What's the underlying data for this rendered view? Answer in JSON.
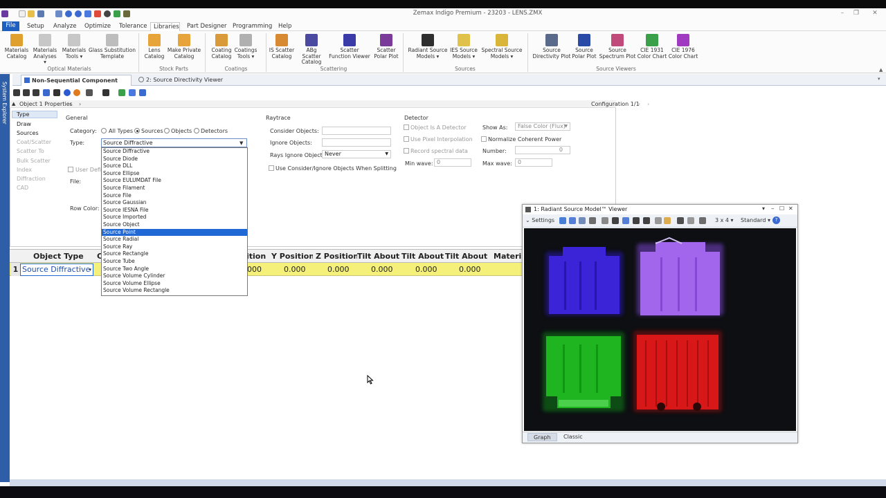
{
  "window": {
    "title": "Zemax Indigo Premium - 23203 - LENS.ZMX"
  },
  "menu": [
    "File",
    "Setup",
    "Analyze",
    "Optimize",
    "Tolerance",
    "Libraries",
    "Part Designer",
    "Programming",
    "Help"
  ],
  "ribbon": {
    "buttons": [
      {
        "l1": "Materials",
        "l2": "Catalog",
        "color": "#e0a030"
      },
      {
        "l1": "Materials",
        "l2": "Analyses ▾",
        "color": "#c7c7c7"
      },
      {
        "l1": "Materials",
        "l2": "Tools ▾",
        "color": "#c7c7c7"
      },
      {
        "l1": "Glass Substitution",
        "l2": "Template",
        "color": "#bdbdbd"
      },
      {
        "l1": "Lens",
        "l2": "Catalog",
        "color": "#e6a43a"
      },
      {
        "l1": "Make Private",
        "l2": "Catalog",
        "color": "#e6a43a"
      },
      {
        "l1": "Coating",
        "l2": "Catalog",
        "color": "#d99a3a"
      },
      {
        "l1": "Coatings",
        "l2": "Tools ▾",
        "color": "#b0b0b0"
      },
      {
        "l1": "IS Scatter",
        "l2": "Catalog",
        "color": "#d88a32"
      },
      {
        "l1": "ABg Scatter",
        "l2": "Catalog",
        "color": "#4a4aa0"
      },
      {
        "l1": "Scatter",
        "l2": "Function Viewer",
        "color": "#3a3aa8"
      },
      {
        "l1": "Scatter",
        "l2": "Polar Plot",
        "color": "#7a3a9a"
      },
      {
        "l1": "Radiant Source",
        "l2": "Models ▾",
        "color": "#2e2e2e"
      },
      {
        "l1": "IES Source",
        "l2": "Models ▾",
        "color": "#e0c24a"
      },
      {
        "l1": "Spectral Source",
        "l2": "Models ▾",
        "color": "#d9b63a"
      },
      {
        "l1": "Source",
        "l2": "Directivity Plot",
        "color": "#5a6a8a"
      },
      {
        "l1": "Source",
        "l2": "Polar Plot",
        "color": "#2a4aa8"
      },
      {
        "l1": "Source",
        "l2": "Spectrum Plot",
        "color": "#c04a7a"
      },
      {
        "l1": "CIE 1931",
        "l2": "Color Chart",
        "color": "#3aa04a"
      },
      {
        "l1": "CIE 1976",
        "l2": "Color Chart",
        "color": "#a03ac0"
      }
    ],
    "groups": [
      "Optical Materials",
      "Stock Parts",
      "Coatings",
      "Scattering",
      "Sources",
      "Source Viewers"
    ]
  },
  "tabs": [
    "Non-Sequential Component Editor",
    "2: Source Directivity Viewer"
  ],
  "side_explorer": "System Explorer",
  "props": {
    "header": "Object 1 Properties",
    "configuration": "Configuration 1/1",
    "nav": [
      "Type",
      "Draw",
      "Sources",
      "Coat/Scatter",
      "Scatter To",
      "Bulk Scatter",
      "Index",
      "Diffraction",
      "CAD"
    ],
    "general": {
      "title": "General",
      "category_label": "Category:",
      "categories": [
        "All Types",
        "Sources",
        "Objects",
        "Detectors"
      ],
      "type_label": "Type:",
      "type_value": "Source Diffractive",
      "user_defined": "User Defin",
      "file_label": "File:",
      "row_color_label": "Row Color:"
    },
    "raytrace": {
      "title": "Raytrace",
      "consider": "Consider Objects:",
      "ignore": "Ignore Objects:",
      "rays_ignore": "Rays Ignore Object:",
      "rays_ignore_value": "Never",
      "use_consider": "Use Consider/Ignore Objects When Splitting"
    },
    "detector": {
      "title": "Detector",
      "object_is_detector": "Object Is A Detector",
      "use_pixel": "Use Pixel Interpolation",
      "record_spectral": "Record spectral data",
      "min_wave": "Min wave:",
      "min_wave_value": "0",
      "show_as": "Show As:",
      "show_as_value": "False Color (Flux)",
      "normalize": "Normalize Coherent Power",
      "number": "Number:",
      "number_value": "0",
      "max_wave": "Max wave:",
      "max_wave_value": "0"
    }
  },
  "type_options": [
    "Source Diffractive",
    "Source Diode",
    "Source DLL",
    "Source Ellipse",
    "Source EULUMDAT File",
    "Source Filament",
    "Source File",
    "Source Gaussian",
    "Source IESNA File",
    "Source Imported",
    "Source Object",
    "Source Point",
    "Source Radial",
    "Source Ray",
    "Source Rectangle",
    "Source Tube",
    "Source Two Angle",
    "Source Volume Cylinder",
    "Source Volume Ellipse",
    "Source Volume Rectangle"
  ],
  "type_selected": "Source Point",
  "grid": {
    "headers": [
      "Object Type",
      "C",
      "ition",
      "Y Position",
      "Z Position",
      "Tilt About X",
      "Tilt About Y",
      "Tilt About Z",
      "Materia"
    ],
    "row_number": "1",
    "object_type": "Source Diffractive",
    "values": [
      "000",
      "0.000",
      "0.000",
      "0.000",
      "0.000",
      "0.000"
    ]
  },
  "viewer": {
    "title": "1: Radiant Source Model™ Viewer",
    "settings": "Settings",
    "layout": "3 x 4",
    "mode": "Standard",
    "tabs": [
      "Graph",
      "Classic"
    ],
    "panels": [
      {
        "name": "blue",
        "color": "#3b24d8"
      },
      {
        "name": "violet",
        "color": "#9c5ee8"
      },
      {
        "name": "green",
        "color": "#1fb520"
      },
      {
        "name": "red",
        "color": "#d81818"
      }
    ]
  }
}
